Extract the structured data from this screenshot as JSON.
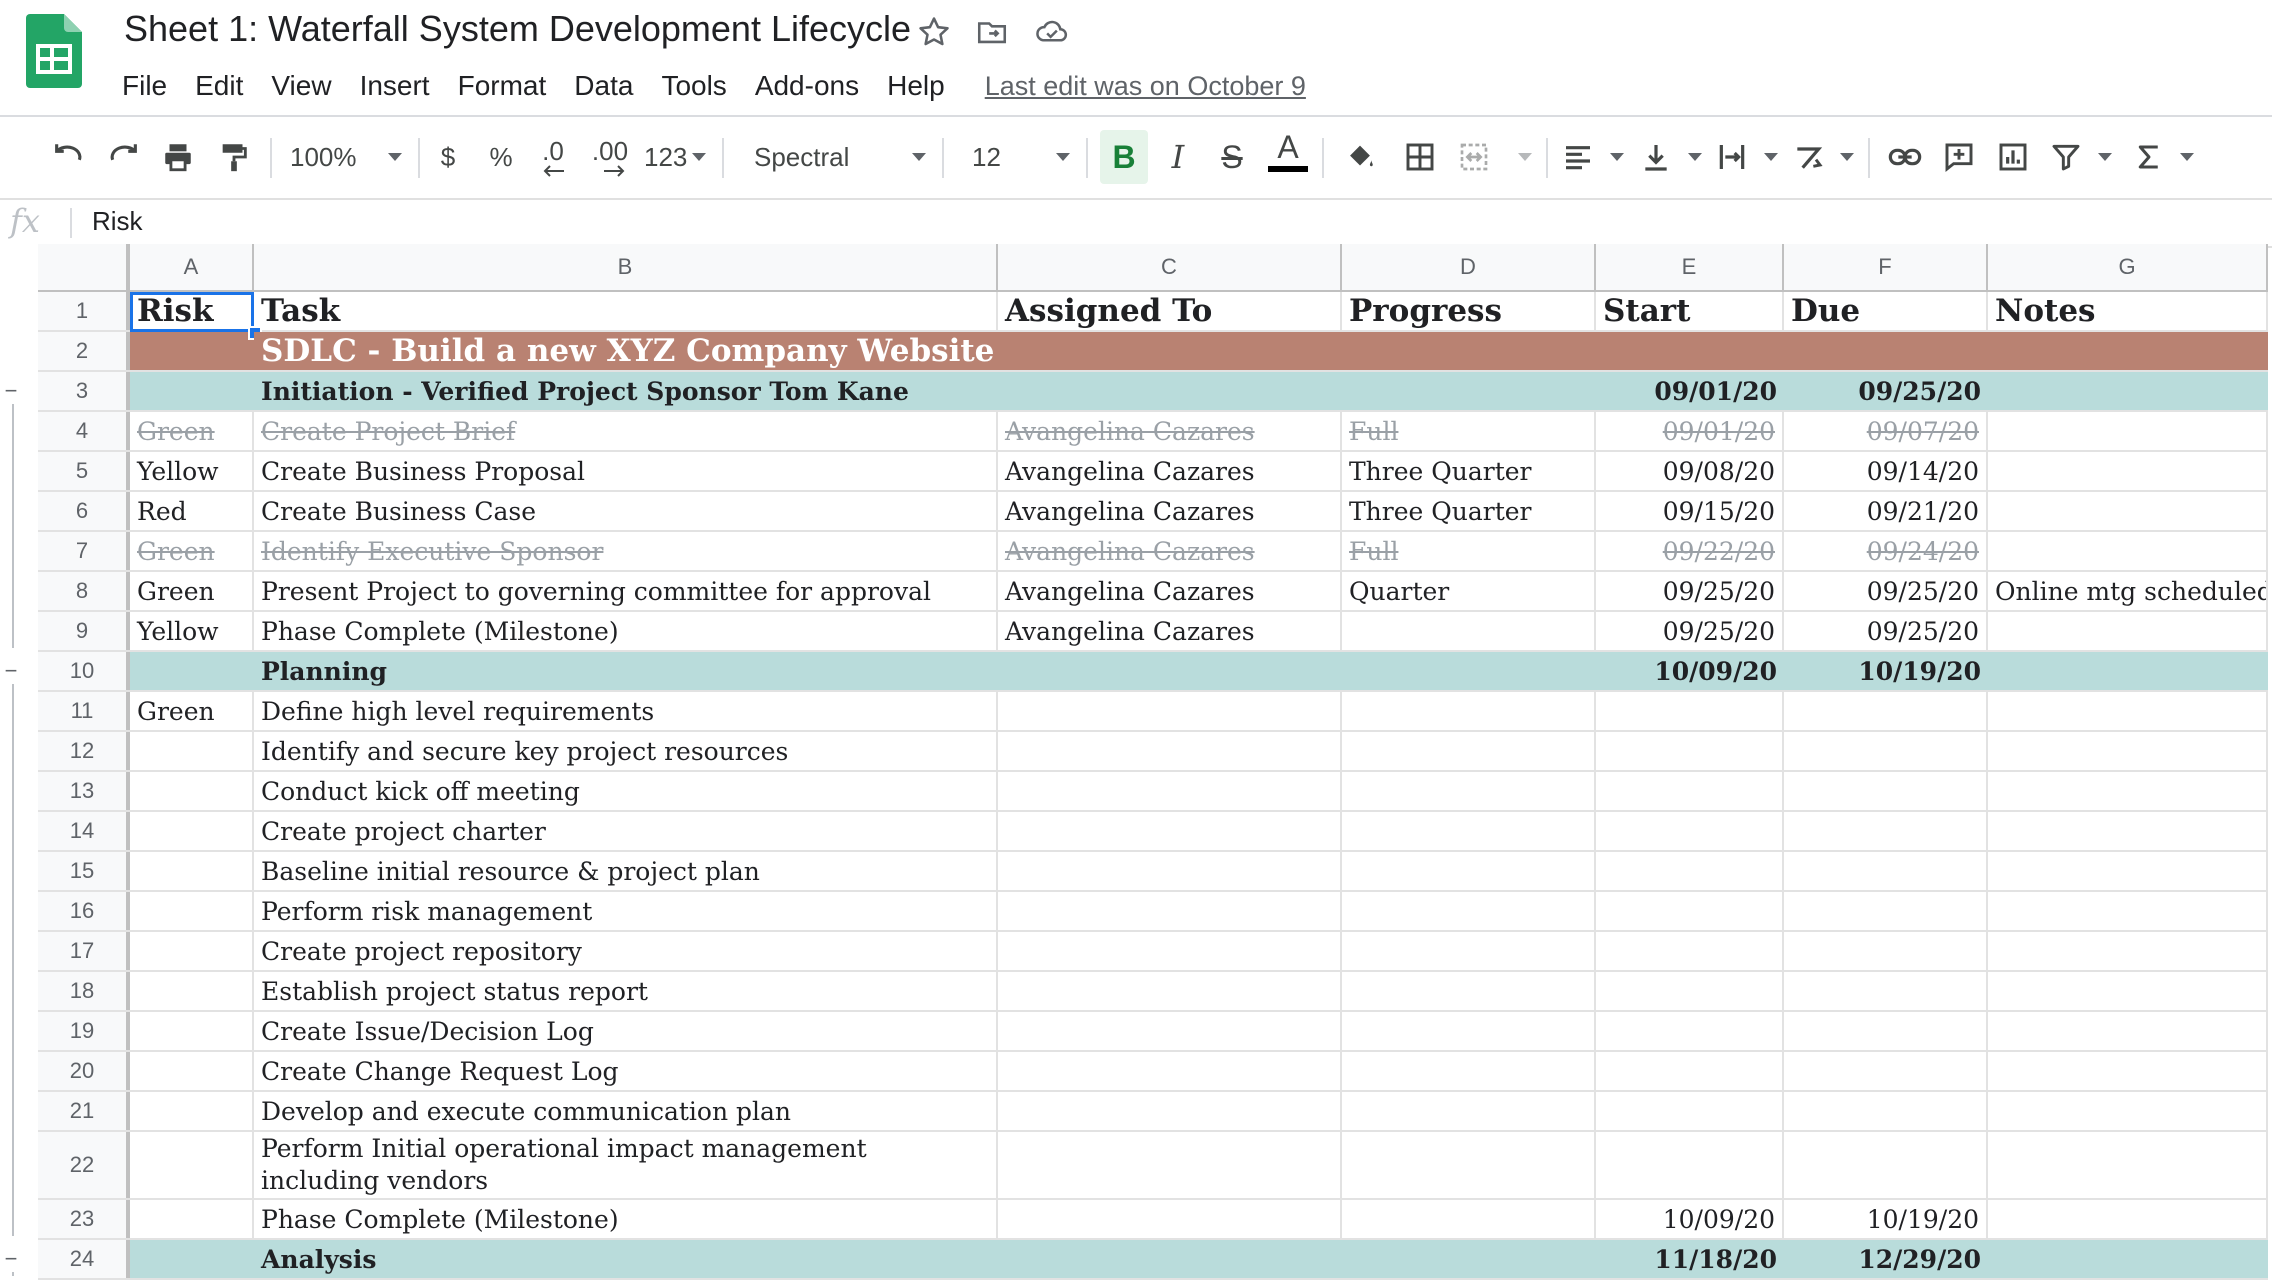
{
  "header": {
    "title": "Sheet 1: Waterfall System Development Lifecycle",
    "menu": [
      "File",
      "Edit",
      "View",
      "Insert",
      "Format",
      "Data",
      "Tools",
      "Add-ons",
      "Help"
    ],
    "last_edit": "Last edit was on October 9"
  },
  "toolbar": {
    "zoom": "100%",
    "currency": "$",
    "percent": "%",
    "decrease_decimal": ".0",
    "increase_decimal": ".00",
    "more_formats": "123",
    "font": "Spectral",
    "font_size": "12",
    "bold": "B",
    "italic": "I",
    "strikethrough": "S",
    "text_color_label": "A",
    "text_color": "#000000",
    "bold_active_bg": "#e6f4ea",
    "bold_active_color": "#188038"
  },
  "formula_bar": {
    "fx": "fx",
    "value": "Risk"
  },
  "colors": {
    "title_row": "#b98272",
    "phase_row": "#b9dcdb",
    "brand_green": "#23a566"
  },
  "columns": [
    "A",
    "B",
    "C",
    "D",
    "E",
    "F",
    "G"
  ],
  "rows": [
    {
      "n": "1",
      "kind": "head",
      "cells": [
        "Risk",
        "Task",
        "Assigned To",
        "Progress",
        "Start",
        "Due",
        "Notes"
      ]
    },
    {
      "n": "2",
      "kind": "title",
      "cells": [
        "",
        "SDLC - Build a new XYZ Company Website",
        "",
        "",
        "",
        "",
        ""
      ]
    },
    {
      "n": "3",
      "kind": "phase",
      "cells": [
        "",
        "Initiation - Verified Project Sponsor Tom Kane",
        "",
        "",
        "09/01/20",
        "09/25/20",
        ""
      ]
    },
    {
      "n": "4",
      "kind": "done",
      "cells": [
        "Green",
        "Create Project Brief",
        "Avangelina Cazares",
        "Full",
        "09/01/20",
        "09/07/20",
        ""
      ]
    },
    {
      "n": "5",
      "kind": "normal",
      "cells": [
        "Yellow",
        "Create Business Proposal",
        "Avangelina Cazares",
        "Three Quarter",
        "09/08/20",
        "09/14/20",
        ""
      ]
    },
    {
      "n": "6",
      "kind": "normal",
      "cells": [
        "Red",
        "Create Business Case",
        "Avangelina Cazares",
        "Three Quarter",
        "09/15/20",
        "09/21/20",
        ""
      ]
    },
    {
      "n": "7",
      "kind": "done",
      "cells": [
        "Green",
        "Identify Executive Sponsor",
        "Avangelina Cazares",
        "Full",
        "09/22/20",
        "09/24/20",
        ""
      ]
    },
    {
      "n": "8",
      "kind": "normal",
      "cells": [
        "Green",
        "Present Project to governing committee for approval",
        "Avangelina Cazares",
        "Quarter",
        "09/25/20",
        "09/25/20",
        "Online mtg scheduled"
      ]
    },
    {
      "n": "9",
      "kind": "normal",
      "cells": [
        "Yellow",
        "Phase Complete (Milestone)",
        "Avangelina Cazares",
        "",
        "09/25/20",
        "09/25/20",
        ""
      ]
    },
    {
      "n": "10",
      "kind": "phase",
      "cells": [
        "",
        "Planning",
        "",
        "",
        "10/09/20",
        "10/19/20",
        ""
      ]
    },
    {
      "n": "11",
      "kind": "normal",
      "cells": [
        "Green",
        "Define high level requirements",
        "",
        "",
        "",
        "",
        ""
      ]
    },
    {
      "n": "12",
      "kind": "normal",
      "cells": [
        "",
        "Identify and secure key project resources",
        "",
        "",
        "",
        "",
        ""
      ]
    },
    {
      "n": "13",
      "kind": "normal",
      "cells": [
        "",
        "Conduct kick off meeting",
        "",
        "",
        "",
        "",
        ""
      ]
    },
    {
      "n": "14",
      "kind": "normal",
      "cells": [
        "",
        "Create project charter",
        "",
        "",
        "",
        "",
        ""
      ]
    },
    {
      "n": "15",
      "kind": "normal",
      "cells": [
        "",
        "Baseline initial resource & project plan",
        "",
        "",
        "",
        "",
        ""
      ]
    },
    {
      "n": "16",
      "kind": "normal",
      "cells": [
        "",
        "Perform risk management",
        "",
        "",
        "",
        "",
        ""
      ]
    },
    {
      "n": "17",
      "kind": "normal",
      "cells": [
        "",
        "Create project repository",
        "",
        "",
        "",
        "",
        ""
      ]
    },
    {
      "n": "18",
      "kind": "normal",
      "cells": [
        "",
        "Establish project status report",
        "",
        "",
        "",
        "",
        ""
      ]
    },
    {
      "n": "19",
      "kind": "normal",
      "cells": [
        "",
        "Create Issue/Decision Log",
        "",
        "",
        "",
        "",
        ""
      ]
    },
    {
      "n": "20",
      "kind": "normal",
      "cells": [
        "",
        "Create Change Request Log",
        "",
        "",
        "",
        "",
        ""
      ]
    },
    {
      "n": "21",
      "kind": "normal",
      "cells": [
        "",
        "Develop and execute communication plan",
        "",
        "",
        "",
        "",
        ""
      ]
    },
    {
      "n": "22",
      "kind": "tall",
      "cells": [
        "",
        "Perform Initial operational impact management including vendors",
        "",
        "",
        "",
        "",
        ""
      ]
    },
    {
      "n": "23",
      "kind": "normal",
      "cells": [
        "",
        "Phase Complete (Milestone)",
        "",
        "",
        "10/09/20",
        "10/19/20",
        ""
      ]
    },
    {
      "n": "24",
      "kind": "phase",
      "cells": [
        "",
        "Analysis",
        "",
        "",
        "11/18/20",
        "12/29/20",
        ""
      ]
    }
  ]
}
